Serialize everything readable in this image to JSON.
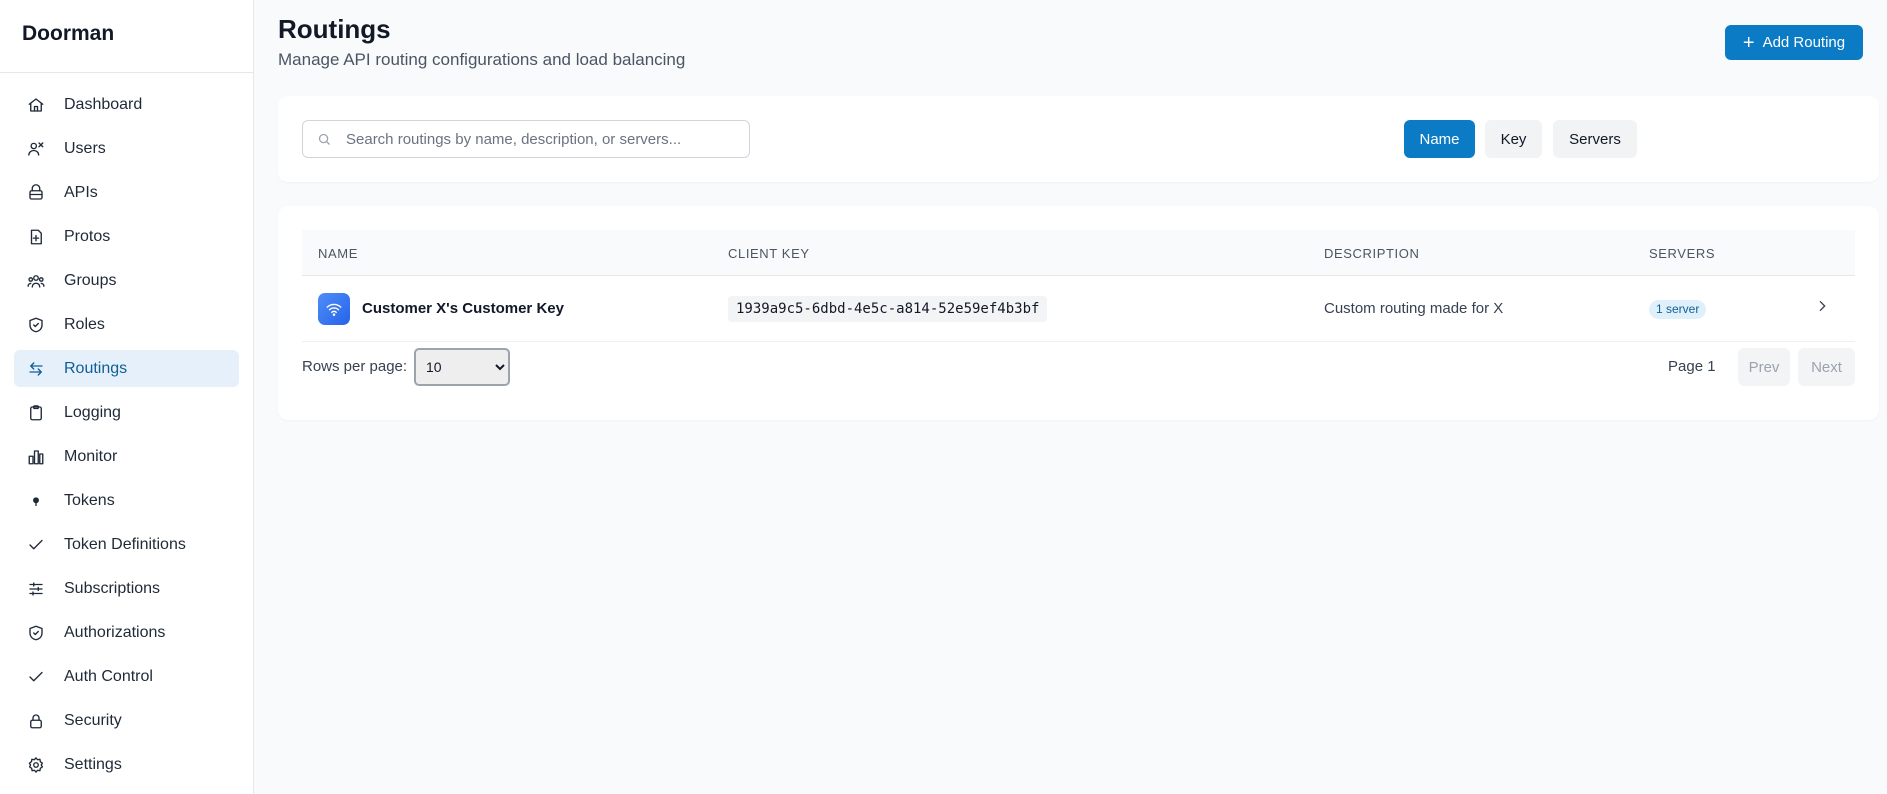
{
  "app": {
    "title": "Doorman"
  },
  "sidebar": {
    "items": [
      {
        "label": "Dashboard",
        "icon": "home-icon"
      },
      {
        "label": "Users",
        "icon": "users-icon"
      },
      {
        "label": "APIs",
        "icon": "layers-icon"
      },
      {
        "label": "Protos",
        "icon": "file-plus-icon"
      },
      {
        "label": "Groups",
        "icon": "group-icon"
      },
      {
        "label": "Roles",
        "icon": "shield-icon"
      },
      {
        "label": "Routings",
        "icon": "arrows-exchange-icon",
        "active": true
      },
      {
        "label": "Logging",
        "icon": "clipboard-icon"
      },
      {
        "label": "Monitor",
        "icon": "bar-chart-icon"
      },
      {
        "label": "Tokens",
        "icon": "dot-icon"
      },
      {
        "label": "Token Definitions",
        "icon": "check-icon"
      },
      {
        "label": "Subscriptions",
        "icon": "sliders-icon"
      },
      {
        "label": "Authorizations",
        "icon": "shield-check-icon"
      },
      {
        "label": "Auth Control",
        "icon": "check-icon"
      },
      {
        "label": "Security",
        "icon": "lock-icon"
      },
      {
        "label": "Settings",
        "icon": "gear-icon"
      }
    ]
  },
  "header": {
    "title": "Routings",
    "subtitle": "Manage API routing configurations and load balancing",
    "add_button": "Add Routing"
  },
  "filters": {
    "search_placeholder": "Search routings by name, description, or servers...",
    "search_value": "",
    "sort_buttons": [
      "Name",
      "Key",
      "Servers"
    ],
    "active_sort": "Name"
  },
  "table": {
    "columns": [
      "NAME",
      "CLIENT KEY",
      "DESCRIPTION",
      "SERVERS"
    ],
    "rows": [
      {
        "name": "Customer X's Customer Key",
        "client_key": "1939a9c5-6dbd-4e5c-a814-52e59ef4b3bf",
        "description": "Custom routing made for X",
        "servers": "1 server"
      }
    ]
  },
  "pagination": {
    "rows_per_page_label": "Rows per page:",
    "rows_per_page_value": "10",
    "page_label": "Page 1",
    "prev": "Prev",
    "next": "Next"
  },
  "colors": {
    "accent": "#0a7bc4",
    "active_nav_bg": "#e6f0fa",
    "badge_bg": "#e0f0fb"
  }
}
